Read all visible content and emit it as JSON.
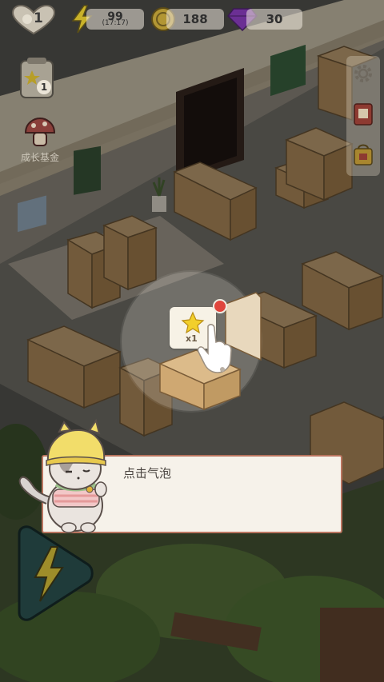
{
  "hud": {
    "level": "1",
    "energy": "99",
    "energy_timer": "(17:17)",
    "coins": "188",
    "gems": "30"
  },
  "left_menu": {
    "badge_count": "1",
    "fund_label": "成长基金"
  },
  "bubble": {
    "multiplier": "x1"
  },
  "dialog": {
    "text": "点击气泡"
  },
  "colors": {
    "energy": "#f2cf2b",
    "coin": "#e2b93a",
    "gem": "#8a3fc4",
    "dialog_border": "#b9745f",
    "notification": "#e0453c"
  }
}
